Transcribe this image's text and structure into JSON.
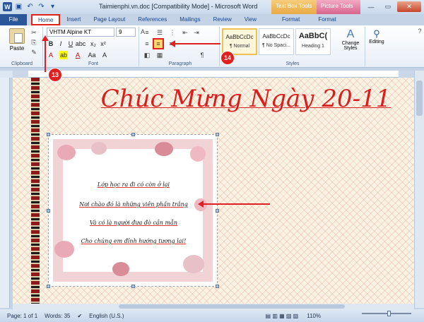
{
  "window": {
    "title": "Taimienphi.vn.doc [Compatibility Mode] - Microsoft Word",
    "app_icon": "W",
    "context_tabs": {
      "text_box_tools": "Text Box Tools",
      "picture_tools": "Picture Tools"
    }
  },
  "tabs": [
    "File",
    "Home",
    "Insert",
    "Page Layout",
    "References",
    "Mailings",
    "Review",
    "View",
    "Format",
    "Format"
  ],
  "ribbon": {
    "clipboard": {
      "label": "Clipboard",
      "paste": "Paste"
    },
    "font": {
      "label": "Font",
      "face": "VHTM Alpine KT",
      "size": "9"
    },
    "paragraph": {
      "label": "Paragraph"
    },
    "styles": {
      "label": "Styles",
      "items": [
        {
          "preview": "AaBbCcDc",
          "name": "¶ Normal"
        },
        {
          "preview": "AaBbCcDc",
          "name": "¶ No Spaci..."
        },
        {
          "preview": "AaBbC(",
          "name": "Heading 1"
        }
      ],
      "change_styles": "Change Styles"
    },
    "editing": {
      "label": "Editing"
    }
  },
  "document": {
    "heading": "Chúc Mừng Ngày 20-11",
    "card_lines": [
      "Lớp học ra đi có còn ở lại",
      "Nơi chào đó là những viên phấn trắng",
      "Và có là người đưa đò cần mẫn",
      "Cho chúng em đỉnh hướng tương lai!"
    ]
  },
  "status": {
    "page": "Page: 1 of 1",
    "words": "Words: 35",
    "language": "English (U.S.)",
    "zoom": "110%"
  },
  "callouts": {
    "a": "13",
    "b": "14"
  },
  "colors": {
    "accent": "#2b579a",
    "callout": "#e02020",
    "heading": "#d81e1e"
  }
}
